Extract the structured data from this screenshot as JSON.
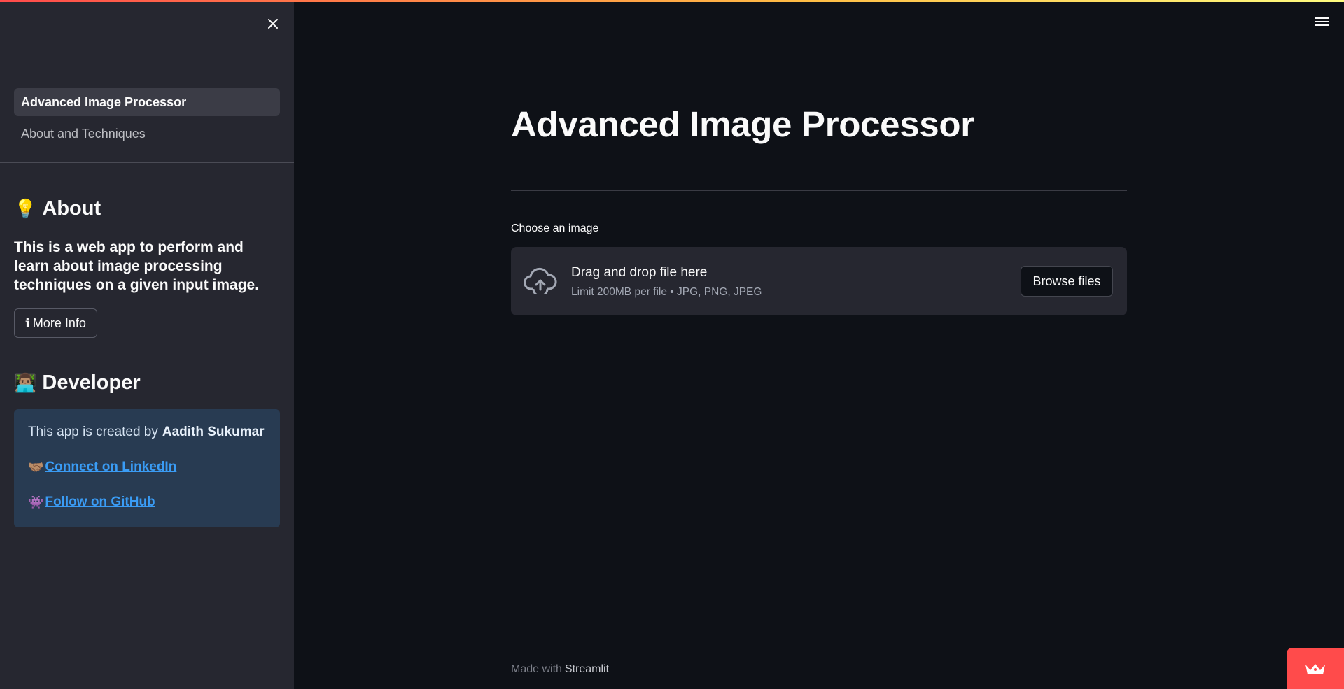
{
  "app": {
    "accent_color": "#ff4b4b",
    "background_color": "#0e1117",
    "sidebar_color": "#262730"
  },
  "sidebar": {
    "close_icon": "close-icon",
    "nav": [
      {
        "label": "Advanced Image Processor",
        "active": true
      },
      {
        "label": "About and Techniques",
        "active": false
      }
    ],
    "about": {
      "emoji": "💡",
      "heading": "About",
      "text": "This is a web app to perform and learn about image processing techniques on a given input image.",
      "button_icon": "ℹ",
      "button_label": "More Info"
    },
    "developer": {
      "emoji": "👨🏽‍💻",
      "heading": "Developer",
      "created_by_prefix": "This app is created by",
      "author_name": "Aadith Sukumar",
      "linkedin_emoji": "🤝🏽",
      "linkedin_label": "Connect on LinkedIn",
      "github_emoji": "👾",
      "github_label": "Follow on GitHub"
    }
  },
  "header": {
    "menu_icon": "hamburger-menu-icon"
  },
  "main": {
    "title": "Advanced Image Processor",
    "uploader": {
      "label": "Choose an image",
      "icon": "cloud-upload-icon",
      "drop_text": "Drag and drop file here",
      "limit_text": "Limit 200MB per file • JPG, PNG, JPEG",
      "browse_label": "Browse files"
    }
  },
  "footer": {
    "prefix": "Made with",
    "brand": "Streamlit"
  },
  "deploy_badge": {
    "icon": "crown-icon"
  }
}
